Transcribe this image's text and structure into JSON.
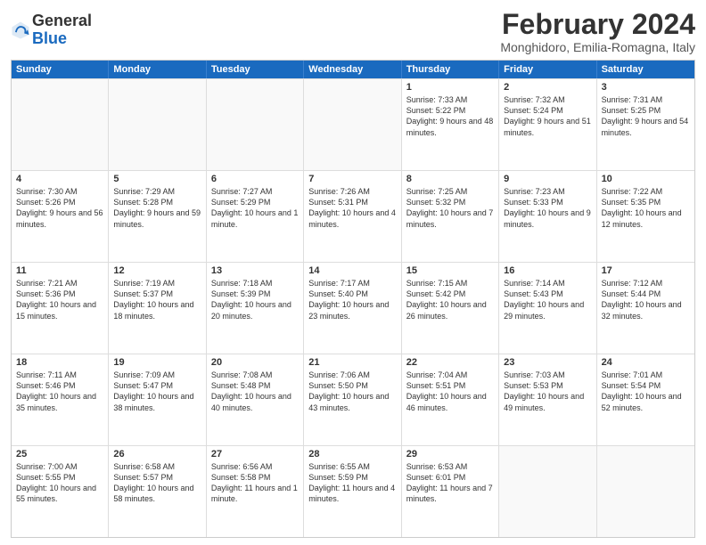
{
  "header": {
    "logo_general": "General",
    "logo_blue": "Blue",
    "title": "February 2024",
    "subtitle": "Monghidoro, Emilia-Romagna, Italy"
  },
  "calendar": {
    "days_of_week": [
      "Sunday",
      "Monday",
      "Tuesday",
      "Wednesday",
      "Thursday",
      "Friday",
      "Saturday"
    ],
    "weeks": [
      [
        {
          "day": "",
          "empty": true
        },
        {
          "day": "",
          "empty": true
        },
        {
          "day": "",
          "empty": true
        },
        {
          "day": "",
          "empty": true
        },
        {
          "day": "1",
          "sunrise": "7:33 AM",
          "sunset": "5:22 PM",
          "daylight": "9 hours and 48 minutes."
        },
        {
          "day": "2",
          "sunrise": "7:32 AM",
          "sunset": "5:24 PM",
          "daylight": "9 hours and 51 minutes."
        },
        {
          "day": "3",
          "sunrise": "7:31 AM",
          "sunset": "5:25 PM",
          "daylight": "9 hours and 54 minutes."
        }
      ],
      [
        {
          "day": "4",
          "sunrise": "7:30 AM",
          "sunset": "5:26 PM",
          "daylight": "9 hours and 56 minutes."
        },
        {
          "day": "5",
          "sunrise": "7:29 AM",
          "sunset": "5:28 PM",
          "daylight": "9 hours and 59 minutes."
        },
        {
          "day": "6",
          "sunrise": "7:27 AM",
          "sunset": "5:29 PM",
          "daylight": "10 hours and 1 minute."
        },
        {
          "day": "7",
          "sunrise": "7:26 AM",
          "sunset": "5:31 PM",
          "daylight": "10 hours and 4 minutes."
        },
        {
          "day": "8",
          "sunrise": "7:25 AM",
          "sunset": "5:32 PM",
          "daylight": "10 hours and 7 minutes."
        },
        {
          "day": "9",
          "sunrise": "7:23 AM",
          "sunset": "5:33 PM",
          "daylight": "10 hours and 9 minutes."
        },
        {
          "day": "10",
          "sunrise": "7:22 AM",
          "sunset": "5:35 PM",
          "daylight": "10 hours and 12 minutes."
        }
      ],
      [
        {
          "day": "11",
          "sunrise": "7:21 AM",
          "sunset": "5:36 PM",
          "daylight": "10 hours and 15 minutes."
        },
        {
          "day": "12",
          "sunrise": "7:19 AM",
          "sunset": "5:37 PM",
          "daylight": "10 hours and 18 minutes."
        },
        {
          "day": "13",
          "sunrise": "7:18 AM",
          "sunset": "5:39 PM",
          "daylight": "10 hours and 20 minutes."
        },
        {
          "day": "14",
          "sunrise": "7:17 AM",
          "sunset": "5:40 PM",
          "daylight": "10 hours and 23 minutes."
        },
        {
          "day": "15",
          "sunrise": "7:15 AM",
          "sunset": "5:42 PM",
          "daylight": "10 hours and 26 minutes."
        },
        {
          "day": "16",
          "sunrise": "7:14 AM",
          "sunset": "5:43 PM",
          "daylight": "10 hours and 29 minutes."
        },
        {
          "day": "17",
          "sunrise": "7:12 AM",
          "sunset": "5:44 PM",
          "daylight": "10 hours and 32 minutes."
        }
      ],
      [
        {
          "day": "18",
          "sunrise": "7:11 AM",
          "sunset": "5:46 PM",
          "daylight": "10 hours and 35 minutes."
        },
        {
          "day": "19",
          "sunrise": "7:09 AM",
          "sunset": "5:47 PM",
          "daylight": "10 hours and 38 minutes."
        },
        {
          "day": "20",
          "sunrise": "7:08 AM",
          "sunset": "5:48 PM",
          "daylight": "10 hours and 40 minutes."
        },
        {
          "day": "21",
          "sunrise": "7:06 AM",
          "sunset": "5:50 PM",
          "daylight": "10 hours and 43 minutes."
        },
        {
          "day": "22",
          "sunrise": "7:04 AM",
          "sunset": "5:51 PM",
          "daylight": "10 hours and 46 minutes."
        },
        {
          "day": "23",
          "sunrise": "7:03 AM",
          "sunset": "5:53 PM",
          "daylight": "10 hours and 49 minutes."
        },
        {
          "day": "24",
          "sunrise": "7:01 AM",
          "sunset": "5:54 PM",
          "daylight": "10 hours and 52 minutes."
        }
      ],
      [
        {
          "day": "25",
          "sunrise": "7:00 AM",
          "sunset": "5:55 PM",
          "daylight": "10 hours and 55 minutes."
        },
        {
          "day": "26",
          "sunrise": "6:58 AM",
          "sunset": "5:57 PM",
          "daylight": "10 hours and 58 minutes."
        },
        {
          "day": "27",
          "sunrise": "6:56 AM",
          "sunset": "5:58 PM",
          "daylight": "11 hours and 1 minute."
        },
        {
          "day": "28",
          "sunrise": "6:55 AM",
          "sunset": "5:59 PM",
          "daylight": "11 hours and 4 minutes."
        },
        {
          "day": "29",
          "sunrise": "6:53 AM",
          "sunset": "6:01 PM",
          "daylight": "11 hours and 7 minutes."
        },
        {
          "day": "",
          "empty": true
        },
        {
          "day": "",
          "empty": true
        }
      ]
    ]
  }
}
